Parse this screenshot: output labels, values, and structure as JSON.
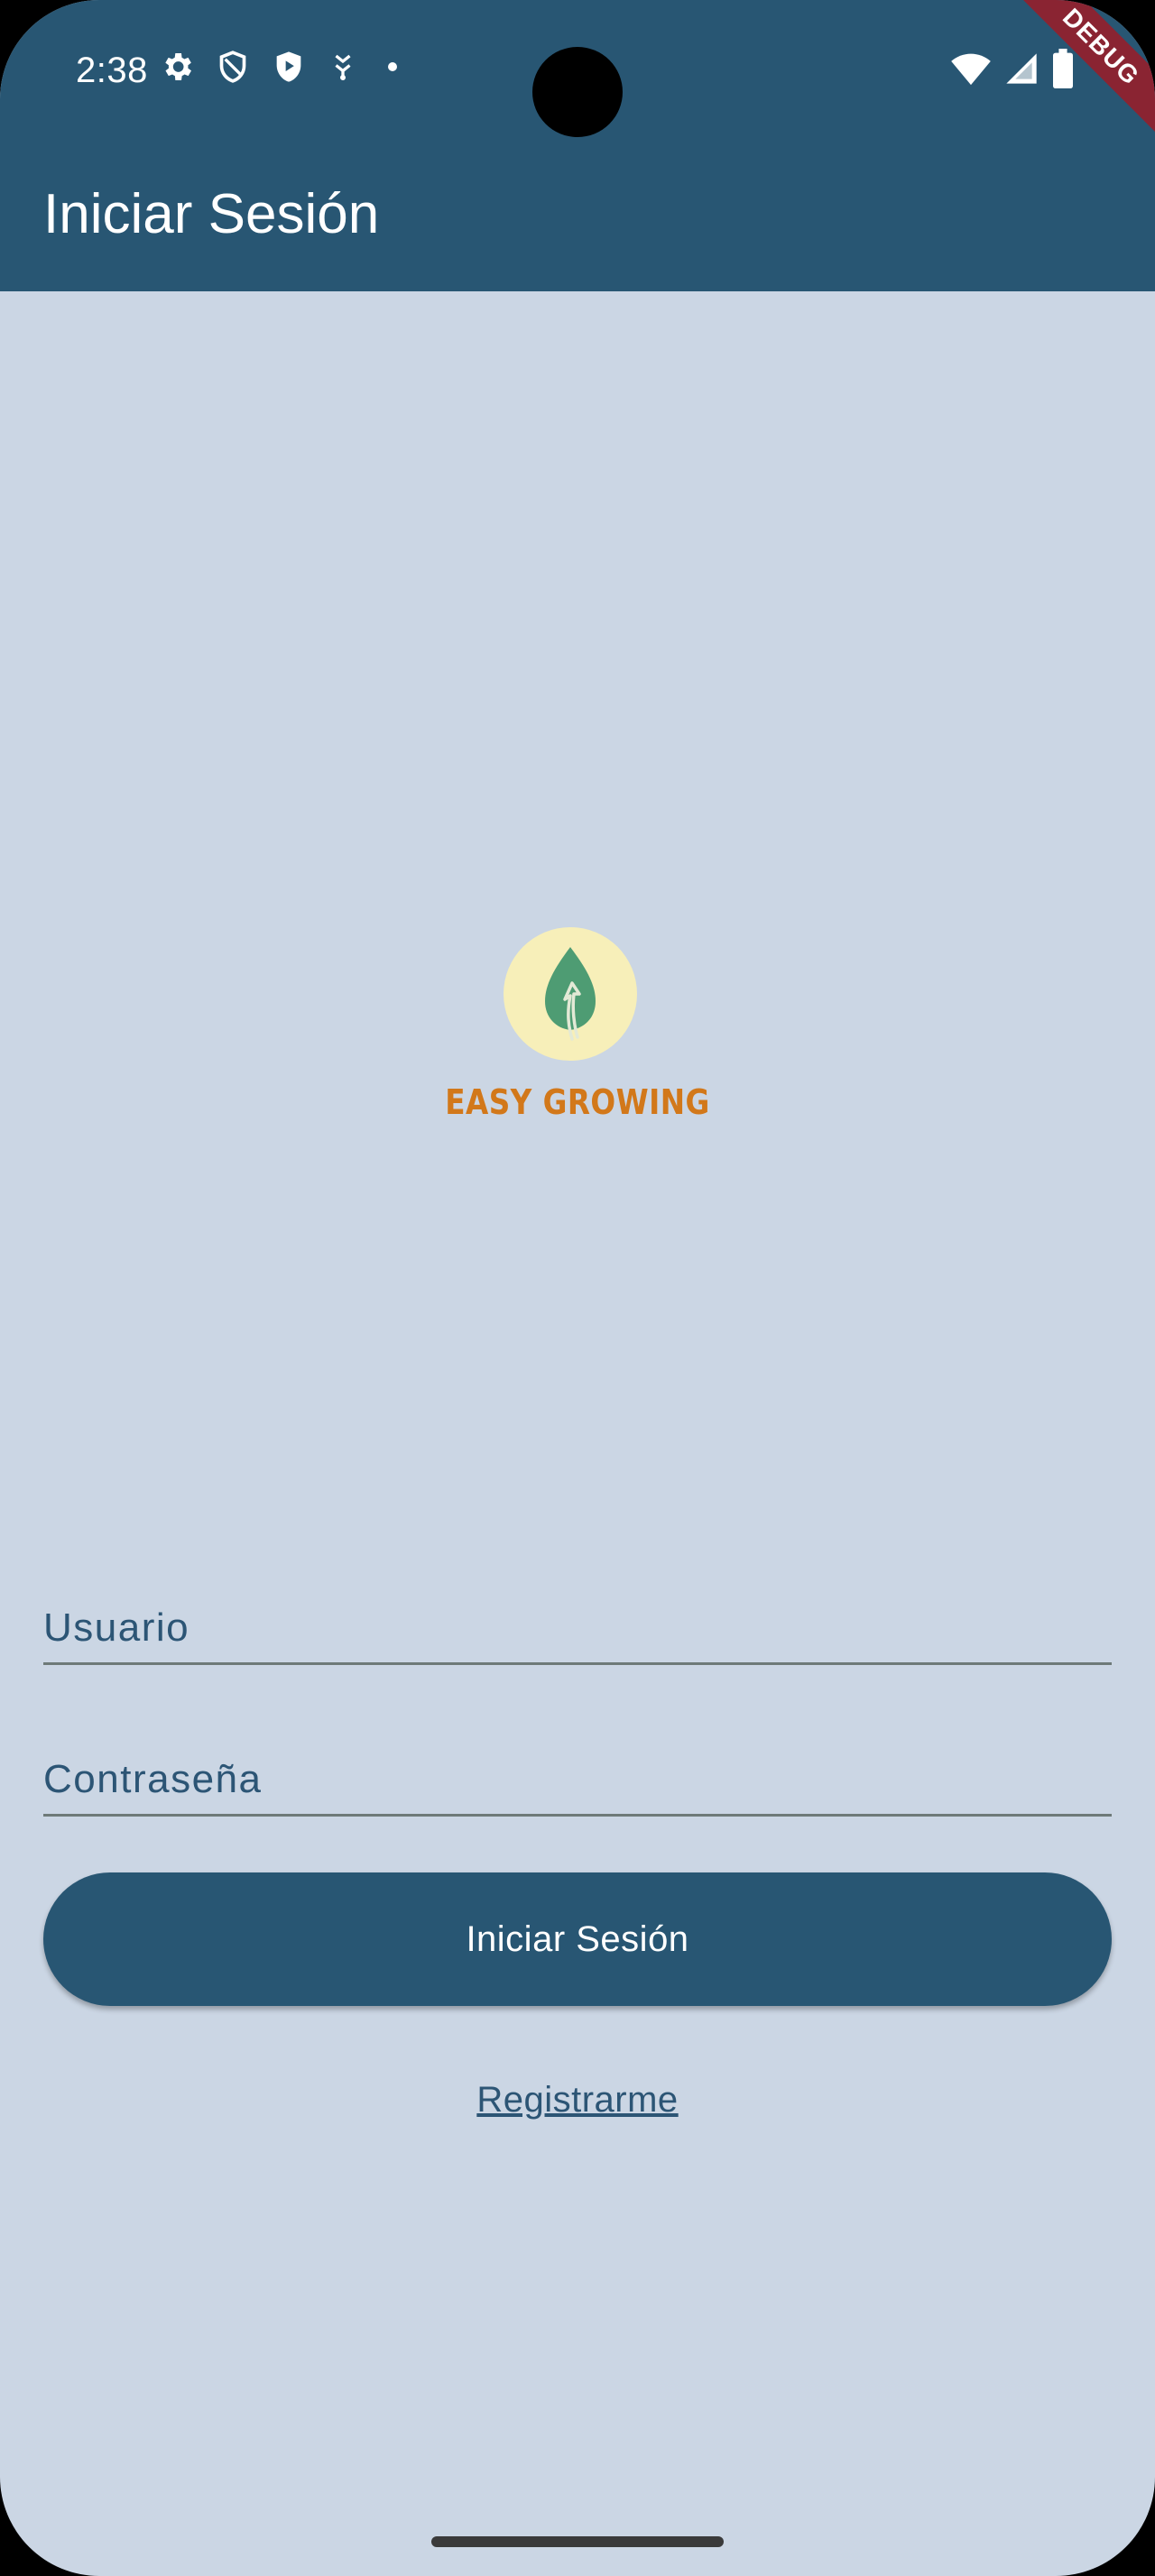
{
  "status_bar": {
    "time": "2:38",
    "icons_left": [
      "settings-icon",
      "shield-icon",
      "play-protect-icon",
      "location-icon",
      "dot-icon"
    ],
    "icons_right": [
      "wifi-icon",
      "signal-icon",
      "battery-icon"
    ],
    "debug_banner": "DEBUG"
  },
  "app_bar": {
    "title": "Iniciar Sesión"
  },
  "logo": {
    "icon": "leaf-icon",
    "brand_text": "EASY GROWING"
  },
  "form": {
    "username_placeholder": "Usuario",
    "username_value": "",
    "password_placeholder": "Contraseña",
    "password_value": "",
    "login_button_label": "Iniciar Sesión",
    "register_link_label": "Registrarme"
  },
  "colors": {
    "primary": "#285673",
    "background": "#CBD6E4",
    "brand_orange": "#D2781A",
    "logo_circle": "#F7EFB9",
    "leaf_green": "#4E9C73"
  }
}
